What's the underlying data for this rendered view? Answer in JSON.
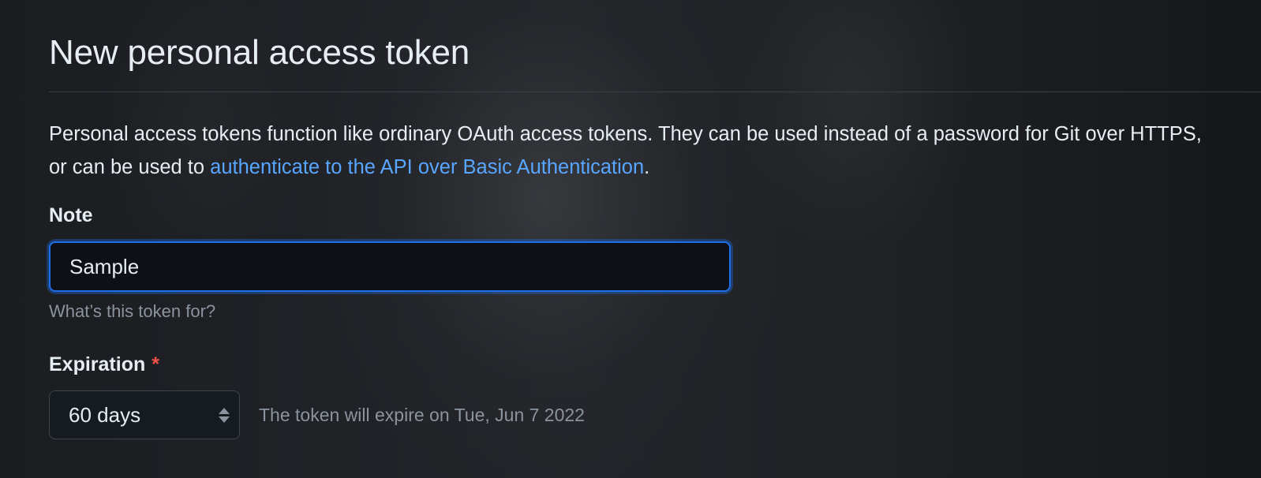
{
  "page": {
    "title": "New personal access token"
  },
  "description": {
    "text_before": "Personal access tokens function like ordinary OAuth access tokens. They can be used instead of a password for Git over HTTPS, or can be used to ",
    "link_text": "authenticate to the API over Basic Authentication",
    "text_after": "."
  },
  "note": {
    "label": "Note",
    "value": "Sample",
    "hint": "What’s this token for?"
  },
  "expiration": {
    "label": "Expiration",
    "required_marker": "*",
    "selected": "60 days",
    "expire_text": "The token will expire on Tue, Jun 7 2022",
    "select_icon": "updown-arrows-icon"
  },
  "colors": {
    "link": "#58a6ff",
    "focus_border": "#1f6feb",
    "required": "#f85149",
    "muted_text": "#8b949e"
  }
}
